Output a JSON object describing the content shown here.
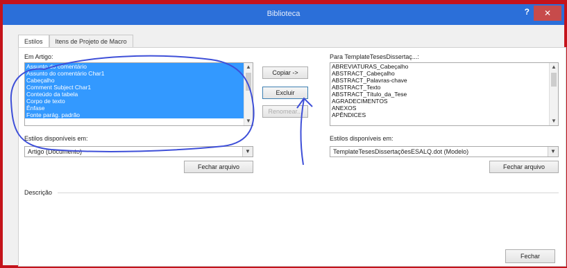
{
  "window": {
    "title": "Biblioteca",
    "help": "?",
    "close": "✕"
  },
  "tabs": [
    {
      "label": "Estilos",
      "active": true
    },
    {
      "label": "Itens de Projeto de Macro",
      "active": false
    }
  ],
  "left": {
    "label": "Em Artigo:",
    "items": [
      "Assunto do comentário",
      "Assunto do comentário Char1",
      "Cabeçalho",
      "Comment Subject Char1",
      "Conteúdo da tabela",
      "Corpo de texto",
      "Ênfase",
      "Fonte parág. padrão"
    ],
    "avail_label": "Estilos disponíveis em:",
    "combo_value": "Artigo (Documento)",
    "close_file": "Fechar arquivo"
  },
  "right": {
    "label": "Para TemplateTesesDissertaç...:",
    "items": [
      "ABREVIATURAS_Cabeçalho",
      "ABSTRACT_Cabeçalho",
      "ABSTRACT_Palavras-chave",
      "ABSTRACT_Texto",
      "ABSTRACT_Título_da_Tese",
      "AGRADECIMENTOS",
      "ANEXOS",
      "APÊNDICES"
    ],
    "avail_label": "Estilos disponíveis em:",
    "combo_value": "TemplateTesesDissertaçõesESALQ.dot (Modelo)",
    "close_file": "Fechar arquivo"
  },
  "middle": {
    "copy": "Copiar ->",
    "delete": "Excluir",
    "rename": "Renomear..."
  },
  "description_label": "Descrição",
  "footer": {
    "close": "Fechar"
  },
  "colors": {
    "selection": "#3399ff",
    "titlebar": "#2b6fd9",
    "border": "#c4131b",
    "ink": "#3e4fd8"
  },
  "icons": {
    "dropdown": "chevron-down-icon",
    "scroll_up": "arrow-up-icon",
    "scroll_down": "arrow-down-icon"
  }
}
